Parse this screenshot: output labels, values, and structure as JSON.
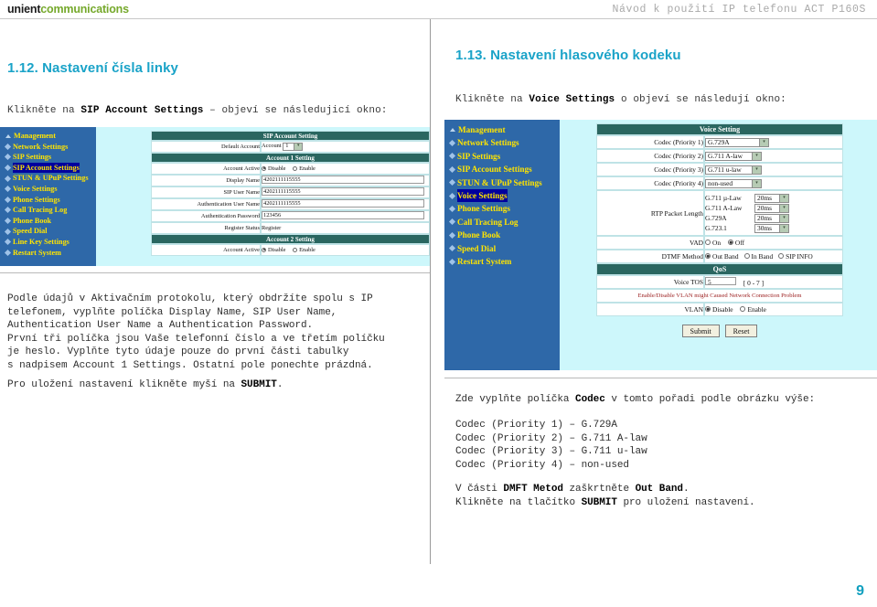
{
  "header": {
    "logo_part1": "unient",
    "logo_part2": "communications",
    "doc_title": "Návod k použití IP telefonu ACT P160S"
  },
  "page_number": "9",
  "left_column": {
    "heading": "1.12. Nastavení čísla linky",
    "lead_pre": "Klikněte na ",
    "lead_bold": "SIP Account Settings",
    "lead_post": " – objeví se následujicí okno:",
    "paragraph_1": "Podle údajů v Aktivačním protokolu, který obdržíte spolu s IP\ntelefonem, vyplňte políčka Display Name, SIP User Name,\nAuthentication User Name a Authentication Password.\nPrvní tři políčka jsou Vaše telefonní číslo a ve třetím políčku\nje heslo. Vyplňte tyto údaje pouze do první části tabulky\ns nadpisem Account 1 Settings. Ostatní pole ponechte prázdná.",
    "paragraph_2_pre": "Pro uložení nastavení klikněte myší na ",
    "paragraph_2_bold": "SUBMIT",
    "paragraph_2_post": "."
  },
  "right_column": {
    "heading": "1.13. Nastavení hlasového kodeku",
    "lead_pre": "Klikněte na ",
    "lead_bold": "Voice Settings",
    "lead_post": " o objeví se následují okno:",
    "paragraph_1_pre": "Zde vyplňte políčka ",
    "paragraph_1_bold": "Codec",
    "paragraph_1_post": " v tomto pořadi podle obrázku výše:",
    "codec_list": "Codec (Priority 1) – G.729A\nCodec (Priority 2) – G.711 A-law\nCodec (Priority 3) – G.711 u-law\nCodec (Priority 4) – non-used",
    "paragraph_3_l1_a": "V části ",
    "paragraph_3_l1_b": "DMFT Metod",
    "paragraph_3_l1_c": " zaškrtněte ",
    "paragraph_3_l1_d": "Out Band",
    "paragraph_3_l1_e": ".",
    "paragraph_3_l2_a": "Klikněte na tlačítko ",
    "paragraph_3_l2_b": "SUBMIT",
    "paragraph_3_l2_c": " pro uložení nastavení."
  },
  "sip_screenshot": {
    "nav_items": [
      {
        "label": "Management",
        "selected": false,
        "first": true
      },
      {
        "label": "Network Settings",
        "selected": false
      },
      {
        "label": "SIP Settings",
        "selected": false
      },
      {
        "label": "SIP Account Settings",
        "selected": true
      },
      {
        "label": "STUN & UPuP Settings",
        "selected": false
      },
      {
        "label": "Voice Settings",
        "selected": false
      },
      {
        "label": "Phone Settings",
        "selected": false
      },
      {
        "label": "Call Tracing Log",
        "selected": false
      },
      {
        "label": "Phone Book",
        "selected": false
      },
      {
        "label": "Speed Dial",
        "selected": false
      },
      {
        "label": "Line Key Settings",
        "selected": false
      },
      {
        "label": "Restart System",
        "selected": false
      }
    ],
    "title_bar": "SIP Account Setting",
    "default_account_label": "Default Account",
    "default_account_prefix": "Account",
    "default_account_value": "1",
    "account1_bar": "Account 1 Setting",
    "account_active_label": "Account Active",
    "radio_disable": "Disable",
    "radio_enable": "Enable",
    "rows": [
      {
        "label": "Display Name",
        "value": "4202111115555"
      },
      {
        "label": "SIP User Name",
        "value": "4202111115555"
      },
      {
        "label": "Authentication User Name",
        "value": "4202111115555"
      },
      {
        "label": "Authentication Password",
        "value": "123456"
      }
    ],
    "register_status_label": "Register Status",
    "register_status_value": "Register",
    "account2_bar": "Account 2 Setting"
  },
  "voice_screenshot": {
    "nav_items": [
      {
        "label": "Management",
        "selected": false,
        "first": true
      },
      {
        "label": "Network Settings",
        "selected": false
      },
      {
        "label": "SIP Settings",
        "selected": false
      },
      {
        "label": "SIP Account Settings",
        "selected": false
      },
      {
        "label": "STUN & UPuP Settings",
        "selected": false
      },
      {
        "label": "Voice Settings",
        "selected": true
      },
      {
        "label": "Phone Settings",
        "selected": false
      },
      {
        "label": "Call Tracing Log",
        "selected": false
      },
      {
        "label": "Phone Book",
        "selected": false
      },
      {
        "label": "Speed Dial",
        "selected": false
      },
      {
        "label": "Restart System",
        "selected": false
      }
    ],
    "title_bar": "Voice Setting",
    "codec_rows": [
      {
        "label": "Codec (Priority 1)",
        "value": "G.729A",
        "width": 70
      },
      {
        "label": "Codec (Priority 2)",
        "value": "G.711 A-law",
        "width": 62
      },
      {
        "label": "Codec (Priority 3)",
        "value": "G.711 u-law",
        "width": 62
      },
      {
        "label": "Codec (Priority 4)",
        "value": "non-used",
        "width": 62
      }
    ],
    "rtp_label": "RTP Packet Length",
    "rtp_rows": [
      {
        "name": "G.711 µ-Law",
        "value": "20ms"
      },
      {
        "name": "G.711 A-Law",
        "value": "20ms"
      },
      {
        "name": "G.729A",
        "value": "20ms"
      },
      {
        "name": "G.723.1",
        "value": "30ms"
      }
    ],
    "vad_label": "VAD",
    "vad_on": "On",
    "vad_off": "Off",
    "dtmf_label": "DTMF Method",
    "dtmf_options": [
      "Out Band",
      "In Band",
      "SIP INFO"
    ],
    "qos_bar": "QoS",
    "voice_tos_label": "Voice TOS",
    "voice_tos_value": "5",
    "voice_tos_range": "[ 0 - 7 ]",
    "vlan_warning": "Enable/Disable VLAN might Caused Network Connection Problem",
    "vlan_label": "VLAN",
    "vlan_disable": "Disable",
    "vlan_enable": "Enable",
    "submit_label": "Submit",
    "reset_label": "Reset"
  },
  "colors": {
    "heading": "#1aa3c8",
    "logo_green": "#76a92c",
    "nav_bg": "#2e68a8",
    "nav_text": "#ffe400",
    "bar_bg": "#2a6660",
    "content_bg": "#cdf7fb",
    "warning": "#9c2020"
  }
}
